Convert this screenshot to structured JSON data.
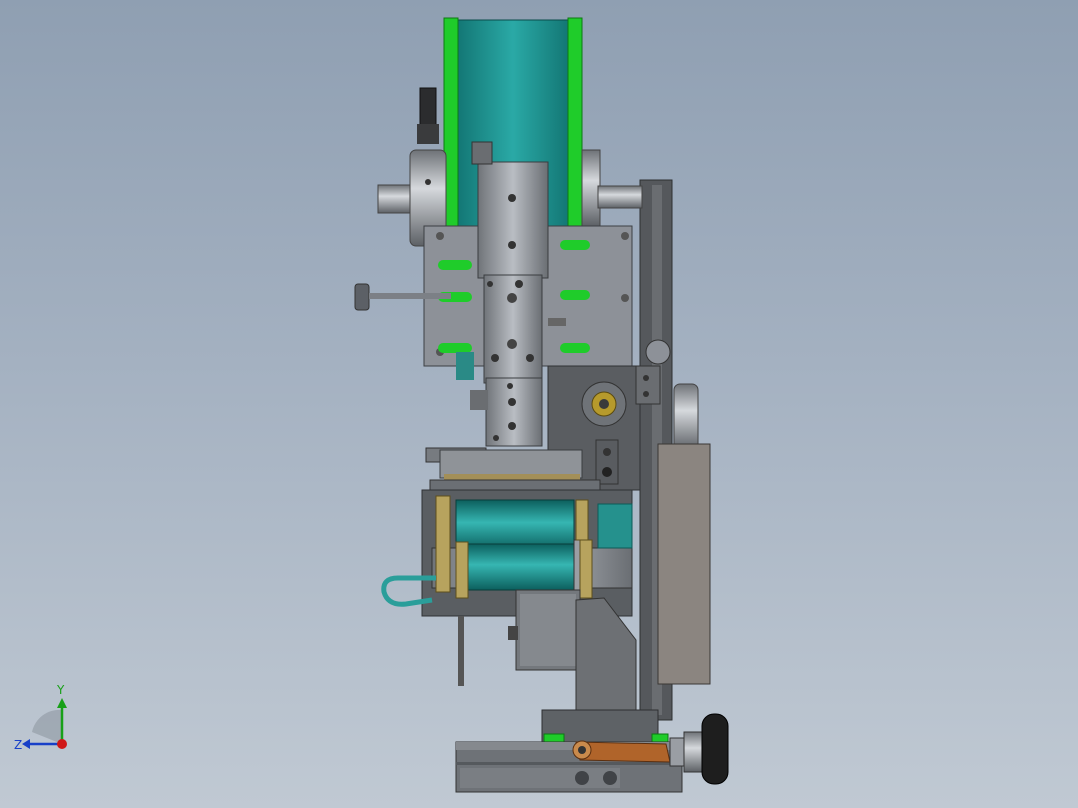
{
  "viewport": {
    "background_top": "#8f9fb2",
    "background_bottom": "#c0c9d3"
  },
  "model": {
    "colors": {
      "teal": "#1e8c8c",
      "green": "#1fcc2a",
      "steel": "#8d9198",
      "dark_steel": "#4d5259",
      "frame": "#5a5d61",
      "motor_panel": "#8b8580",
      "brown_link": "#b0642a",
      "knob": "#222222"
    }
  },
  "triad": {
    "y_label": "Y",
    "z_label": "Z",
    "x_axis_color": "#d01818",
    "y_axis_color": "#18a018",
    "z_axis_color": "#1840c8"
  }
}
